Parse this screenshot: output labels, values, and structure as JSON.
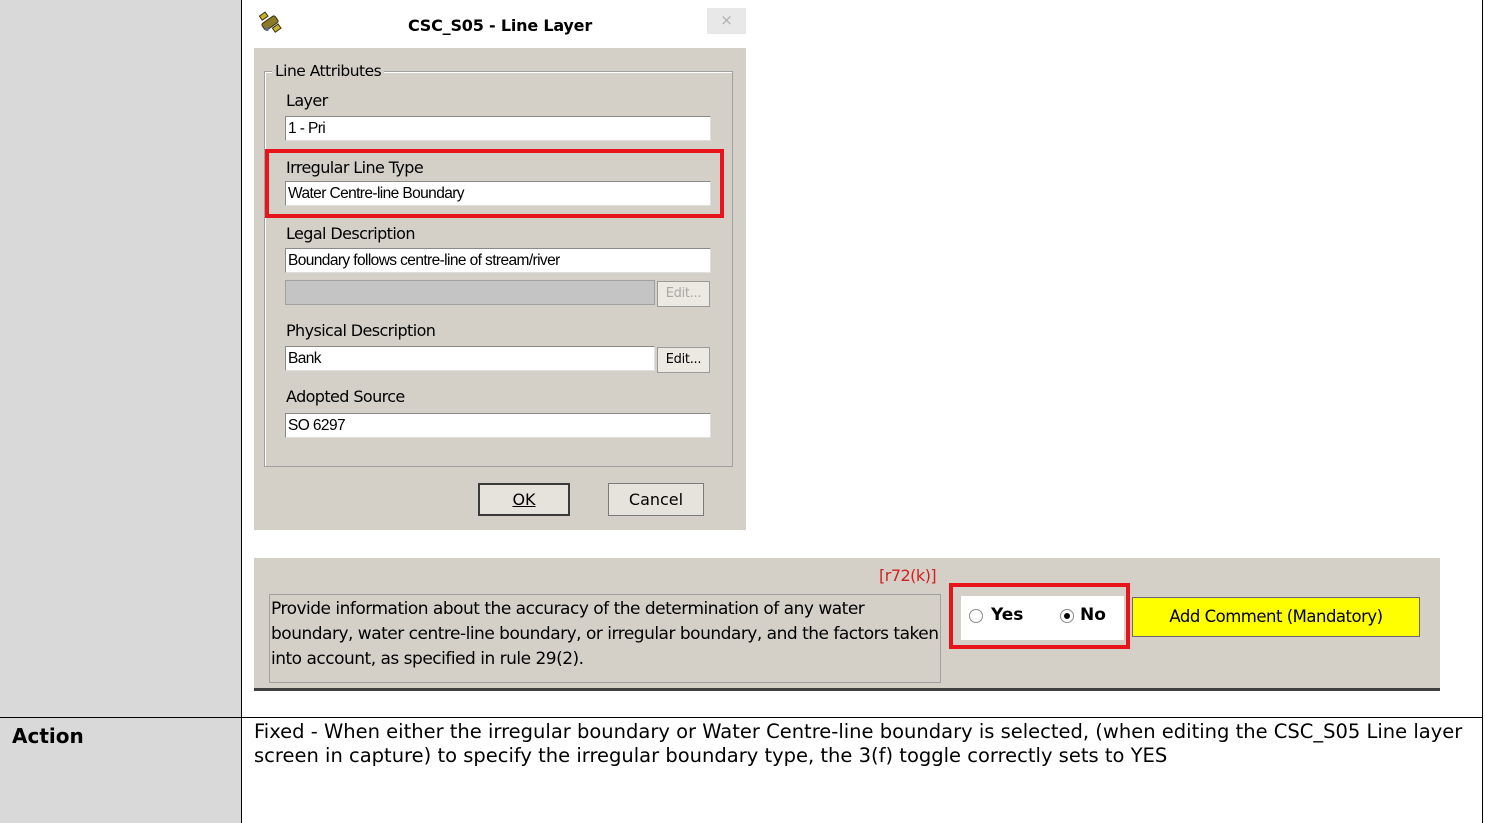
{
  "table": {
    "action_label": "Action",
    "action_text": "Fixed - When either the irregular boundary or Water Centre-line boundary is selected, (when editing the CSC_S05 Line layer screen in capture) to specify the irregular boundary type, the 3(f) toggle correctly sets to YES"
  },
  "dialog": {
    "title": "CSC_S05 - Line Layer",
    "close_glyph": "×",
    "app_icon": "satellite-icon",
    "group_label": "Line Attributes",
    "fields": [
      {
        "label": "Layer",
        "value": "1 - Pri"
      },
      {
        "label": "Irregular Line Type",
        "value": "Water Centre-line Boundary"
      },
      {
        "label": "Legal Description",
        "value": "Boundary follows centre-line of stream/river",
        "value2": "",
        "edit": "Edit..."
      },
      {
        "label": "Physical Description",
        "value": "Bank",
        "edit": "Edit..."
      },
      {
        "label": "Adopted Source",
        "value": "SO 6297"
      }
    ],
    "ok": "OK",
    "cancel": "Cancel"
  },
  "checklist": {
    "rule_ref": "[r72(k)]",
    "question": "Provide information about the accuracy of the determination of any water boundary, water centre-line boundary, or irregular boundary, and the factors taken into account, as specified in rule 29(2).",
    "yes_label": "Yes",
    "no_label": "No",
    "selected": "No",
    "add_comment": "Add Comment (Mandatory)"
  },
  "colors": {
    "highlight": "#e8141c",
    "comment_button": "#ffff00",
    "rule_ref": "#d42020",
    "cell_gray": "#d9d9d9"
  }
}
